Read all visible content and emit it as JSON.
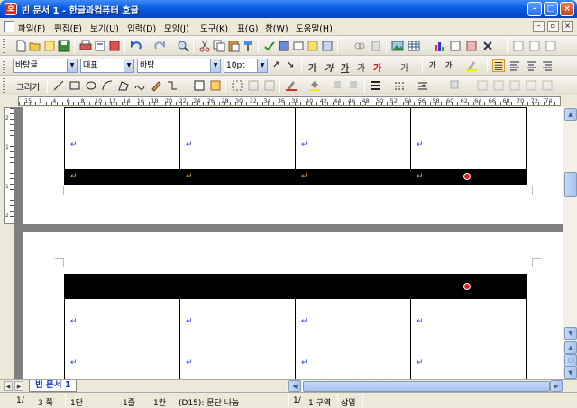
{
  "window": {
    "title": "빈 문서 1 - 한글과컴퓨터 호글",
    "app_icon_glyph": "호",
    "minimize_glyph": "–",
    "maximize_glyph": "□",
    "close_glyph": "×"
  },
  "menu": {
    "items": [
      "파일(F)",
      "편집(E)",
      "보기(U)",
      "입력(D)",
      "모양(J)",
      "도구(K)",
      "표(G)",
      "창(W)",
      "도움말(H)"
    ],
    "mdi_minimize": "–",
    "mdi_restore": "▫",
    "mdi_close": "×"
  },
  "format_bar": {
    "style_value": "바탕글",
    "lang_value": "대표",
    "font_value": "바탕",
    "size_value": "10",
    "size_unit": "pt",
    "char_buttons": [
      "가",
      "가",
      "가",
      "가",
      "가",
      "가",
      "가",
      "가"
    ]
  },
  "draw_bar": {
    "label": "그리기"
  },
  "ruler": {
    "numbers": [
      "15",
      "1",
      "4",
      "6",
      "8",
      "10",
      "12",
      "14",
      "16",
      "18",
      "20",
      "22",
      "24",
      "26",
      "28",
      "30",
      "32",
      "34",
      "36",
      "38",
      "40",
      "42",
      "44",
      "46",
      "48",
      "50",
      "52",
      "54",
      "56",
      "58",
      "60",
      "62",
      "64",
      "66",
      "68",
      "70",
      "72",
      "74",
      "76"
    ],
    "vertical_numbers": [
      "2",
      "1",
      "1",
      "2"
    ]
  },
  "document": {
    "return_mark": "↵",
    "page1_rows": [
      {
        "dark": false,
        "cells": [
          "",
          "",
          "",
          ""
        ]
      },
      {
        "dark": false,
        "cells": [
          "↵",
          "↵",
          "↵",
          "↵"
        ]
      },
      {
        "dark": true,
        "cells": [
          "↵",
          "↵",
          "↵",
          "↵"
        ]
      }
    ],
    "page2_rows": [
      {
        "dark": true,
        "cells": [
          "",
          "",
          "",
          ""
        ]
      },
      {
        "dark": false,
        "cells": [
          "↵",
          "↵",
          "↵",
          "↵"
        ]
      },
      {
        "dark": false,
        "cells": [
          "↵",
          "↵",
          "↵",
          "↵"
        ]
      }
    ]
  },
  "tabs": {
    "active": "빈 문서 1"
  },
  "status": {
    "page": "1/",
    "total_pages": "3 쪽",
    "section": "1단",
    "line": "1줄",
    "column": "1칸",
    "cell": "(D15): 문단 나눔",
    "area": "1/",
    "area_label": "1 구역",
    "mode": "삽입"
  },
  "colors": {
    "titlebar": "#0a5ce0",
    "return_mark_light": "#2244ee",
    "return_mark_dark": "#d7a63c",
    "red_dot": "#e81818",
    "active_tab_text": "#1a3acb"
  }
}
